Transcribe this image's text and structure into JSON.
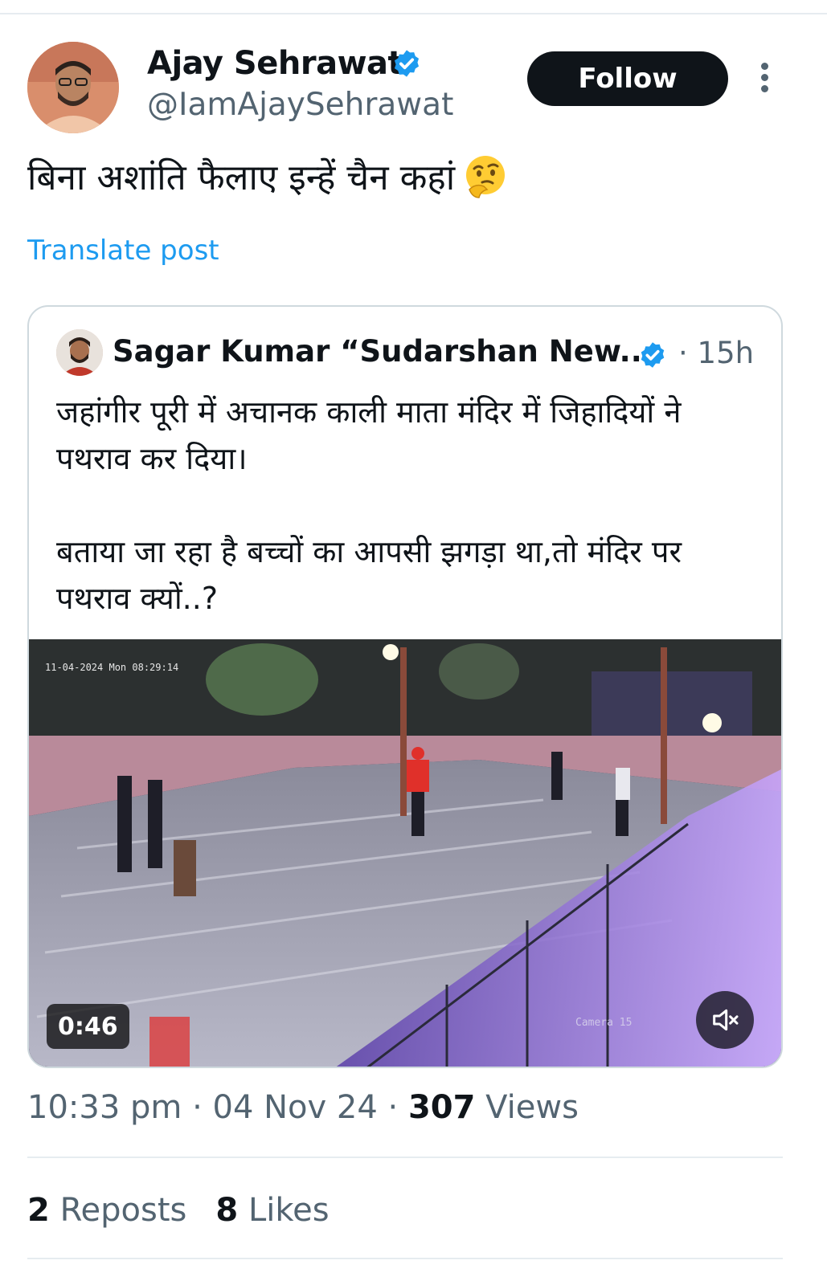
{
  "author": {
    "display_name": "Ajay Sehrawat",
    "handle": "@IamAjaySehrawat",
    "verified": true
  },
  "follow_label": "Follow",
  "post": {
    "text": "बिना अशांति फैलाए इन्हें चैन कहां",
    "emoji": "thinking-face",
    "translate_label": "Translate post"
  },
  "quoted_post": {
    "author_name": "Sagar Kumar “Sudarshan New...",
    "verified": true,
    "time": "· 15h",
    "text_lines": [
      "जहांगीर पूरी में अचानक काली माता मंदिर में जिहादियों ने",
      "पथराव कर दिया।",
      "",
      "बताया जा रहा है बच्चों का आपसी झगड़ा था,तो मंदिर पर",
      "पथराव क्यों..?"
    ],
    "video": {
      "duration": "0:46",
      "overlay_timestamp": "11-04-2024 Mon 08:29:14",
      "camera_label": "Camera 15",
      "muted": true
    }
  },
  "meta": {
    "time": "10:33 pm",
    "date": "04 Nov 24",
    "views_count": "307",
    "views_label": "Views"
  },
  "stats": {
    "reposts_count": "2",
    "reposts_label": "Reposts",
    "likes_count": "8",
    "likes_label": "Likes"
  },
  "colors": {
    "link": "#1d9bf0",
    "verified": "#1d9bf0",
    "secondary_text": "#536471",
    "follow_button": "#0f1419"
  }
}
